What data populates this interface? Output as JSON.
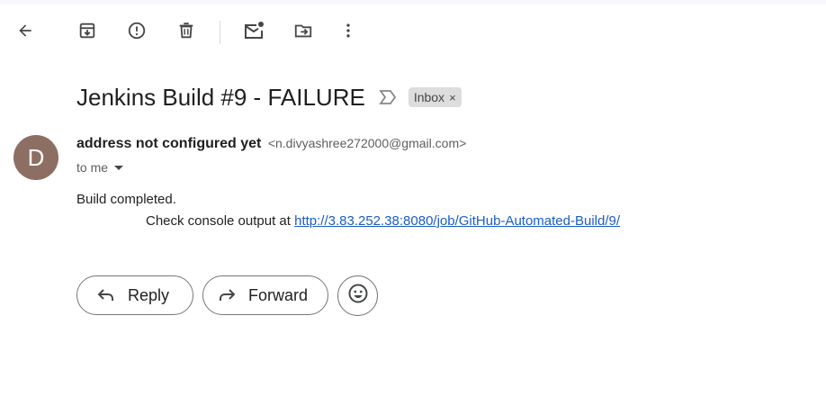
{
  "toolbar": {
    "back": "back-arrow-icon",
    "archive": "archive-icon",
    "report_spam": "report-spam-icon",
    "delete": "trash-icon",
    "mark_unread": "mark-unread-icon",
    "move_to": "move-to-folder-icon",
    "more": "more-vert-icon"
  },
  "email": {
    "subject": "Jenkins Build #9 - FAILURE",
    "label": "Inbox",
    "label_remove": "×",
    "avatar_letter": "D",
    "avatar_color": "#8d6e63",
    "sender_name": "address not configured yet",
    "sender_email": "<n.divyashree272000@gmail.com>",
    "to": "to me",
    "body_line1": "Build completed.",
    "body_line2_prefix": "Check console output at ",
    "body_link": "http://3.83.252.38:8080/job/GitHub-Automated-Build/9/"
  },
  "actions": {
    "reply": "Reply",
    "forward": "Forward",
    "emoji": "emoji-reaction-icon"
  },
  "colors": {
    "link": "#1a5dc7",
    "text": "#1f1f1f",
    "secondary_text": "#5e5e5e",
    "chip_bg": "#dddddd"
  }
}
